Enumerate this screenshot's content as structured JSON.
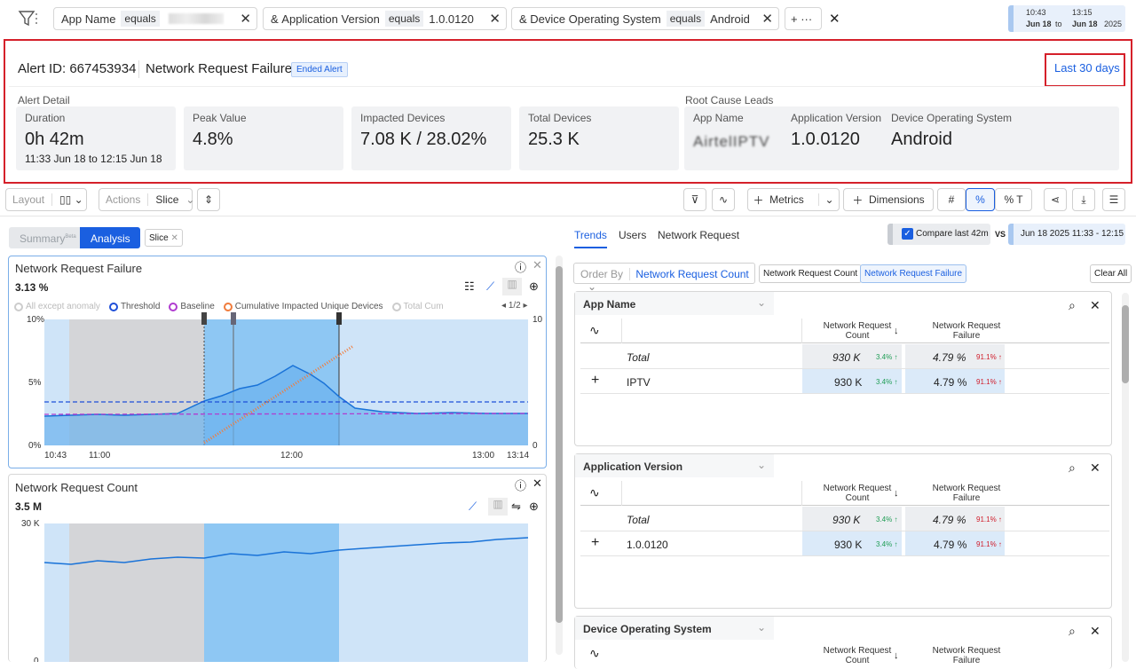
{
  "filters": [
    {
      "field": "App Name",
      "op": "equals",
      "value": ""
    },
    {
      "prefix": "&",
      "field": "Application Version",
      "op": "equals",
      "value": "1.0.0120"
    },
    {
      "prefix": "&",
      "field": "Device Operating System",
      "op": "equals",
      "value": "Android"
    }
  ],
  "filter_more": "+ ···",
  "date_range": {
    "from_time": "10:43",
    "from_date": "Jun 18",
    "to": "to",
    "to_time": "13:15",
    "to_date": "Jun 18",
    "year": "2025"
  },
  "alert": {
    "id_label": "Alert ID: 667453934",
    "name": "Network Request Failure",
    "status_badge": "Ended Alert",
    "range_link": "Last 30 days",
    "detail_title": "Alert Detail",
    "root_title": "Root Cause Leads",
    "cards": [
      {
        "label": "Duration",
        "value": "0h 42m",
        "sub": "11:33 Jun 18 to 12:15 Jun 18"
      },
      {
        "label": "Peak Value",
        "value": "4.8%"
      },
      {
        "label": "Impacted Devices",
        "value": "7.08 K / 28.02%"
      },
      {
        "label": "Total Devices",
        "value": "25.3 K"
      }
    ],
    "root": [
      {
        "label": "App Name",
        "value": "AirtelIPTV"
      },
      {
        "label": "Application Version",
        "value": "1.0.0120"
      },
      {
        "label": "Device Operating System",
        "value": "Android"
      }
    ]
  },
  "toolbar": {
    "layout": "Layout",
    "actions": "Actions",
    "slice": "Slice",
    "metrics": "Metrics",
    "dimensions": "Dimensions",
    "hash": "#",
    "pct": "%",
    "pct_t": "% T"
  },
  "left": {
    "tab_summary": "Summary",
    "beta": "Beta",
    "tab_analysis": "Analysis",
    "slice_chip": "Slice",
    "chart1": {
      "title": "Network Request Failure",
      "value": "3.13 %",
      "page": "1/2",
      "legend": [
        "All except anomaly",
        "Threshold",
        "Baseline",
        "Cumulative Impacted Unique Devices",
        "Total Cum"
      ],
      "yticks": [
        "10%",
        "5%",
        "0%"
      ],
      "y2ticks": [
        "10",
        "0"
      ],
      "xticks": [
        "10:43",
        "11:00",
        "12:00",
        "13:00",
        "13:14"
      ]
    },
    "chart2": {
      "title": "Network Request Count",
      "value": "3.5 M",
      "yticks": [
        "30 K",
        "0"
      ]
    }
  },
  "right": {
    "tabs": [
      "Trends",
      "Users",
      "Network Request"
    ],
    "compare_label": "Compare last 42m",
    "vs": "VS",
    "compare_range": "Jun 18 2025 11:33 - 12:15",
    "order_by": "Order By",
    "order_value": "Network Request Count",
    "order_chips": [
      "Network Request Count",
      "Network Request Failure"
    ],
    "clear_all": "Clear All",
    "col1": "Network Request Count",
    "col2": "Network Request Failure",
    "tables": [
      {
        "title": "App Name",
        "rows": [
          {
            "name": "Total",
            "count": "930 K",
            "count_delta": "3.4%",
            "fail": "4.79 %",
            "fail_delta": "91.1%"
          },
          {
            "name": "IPTV",
            "count": "930 K",
            "count_delta": "3.4%",
            "fail": "4.79 %",
            "fail_delta": "91.1%"
          }
        ]
      },
      {
        "title": "Application Version",
        "rows": [
          {
            "name": "Total",
            "count": "930 K",
            "count_delta": "3.4%",
            "fail": "4.79 %",
            "fail_delta": "91.1%"
          },
          {
            "name": "1.0.0120",
            "count": "930 K",
            "count_delta": "3.4%",
            "fail": "4.79 %",
            "fail_delta": "91.1%"
          }
        ]
      },
      {
        "title": "Device Operating System",
        "rows": []
      }
    ]
  },
  "colors": {
    "accent": "#1a5fe0",
    "alert_border": "#d5202a",
    "anomaly_fill": "#8ec7f3",
    "baseline": "#b03cd0",
    "threshold": "#1f4fd8",
    "cumulative": "#f07c3c"
  }
}
